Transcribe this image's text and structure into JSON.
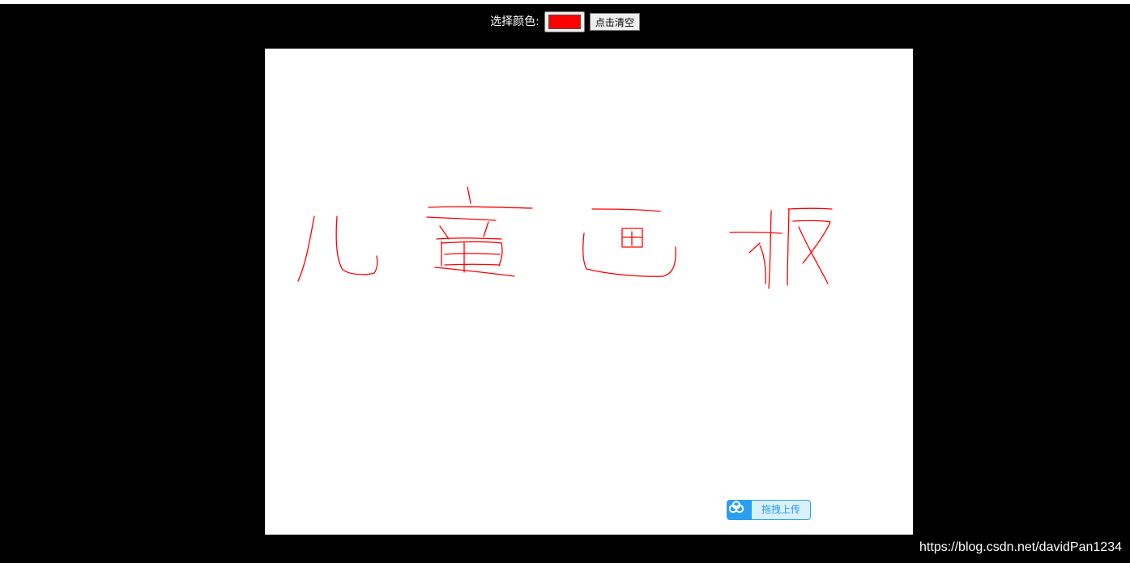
{
  "toolbar": {
    "color_label": "选择颜色:",
    "selected_color": "#ff0000",
    "clear_label": "点击清空"
  },
  "canvas": {
    "background": "#ffffff",
    "stroke_color": "#ff0000"
  },
  "upload_widget": {
    "label": "拖拽上传",
    "icon": "cloud-icon",
    "accent": "#2a9ef0"
  },
  "watermark": {
    "text": "https://blog.csdn.net/davidPan1234"
  }
}
